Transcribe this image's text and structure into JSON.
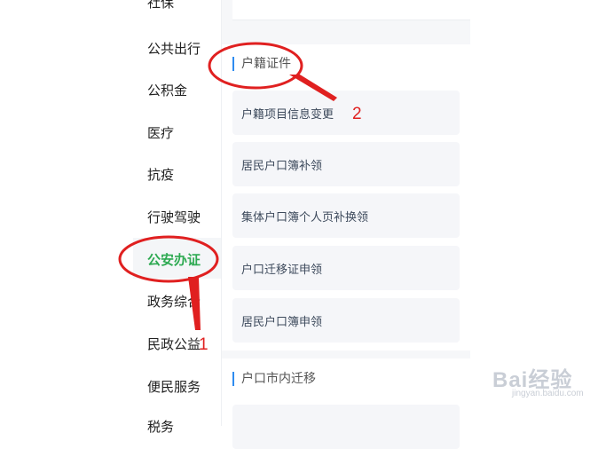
{
  "sidebar": {
    "items": [
      {
        "label": "社保"
      },
      {
        "label": "公共出行"
      },
      {
        "label": "公积金"
      },
      {
        "label": "医疗"
      },
      {
        "label": "抗疫"
      },
      {
        "label": "行驶驾驶"
      },
      {
        "label": "公安办证",
        "active": true
      },
      {
        "label": "政务综合"
      },
      {
        "label": "民政公益"
      },
      {
        "label": "便民服务"
      },
      {
        "label": "税务"
      }
    ]
  },
  "sections": [
    {
      "title": "户籍证件",
      "items": [
        {
          "label": "户籍项目信息变更"
        },
        {
          "label": "居民户口簿补领"
        },
        {
          "label": "集体户口簿个人页补换领"
        },
        {
          "label": "户口迁移证申领"
        },
        {
          "label": "居民户口簿申领"
        }
      ]
    },
    {
      "title": "户口市内迁移",
      "items": []
    }
  ],
  "annotations": {
    "one": "1",
    "two": "2",
    "color": "#e02020"
  },
  "colors": {
    "active": "#2eaa52",
    "accent": "#2e8cf0"
  },
  "watermark": {
    "brand": "Bai",
    "brand_suffix": "经验",
    "url": "jingyan.baidu.com"
  }
}
